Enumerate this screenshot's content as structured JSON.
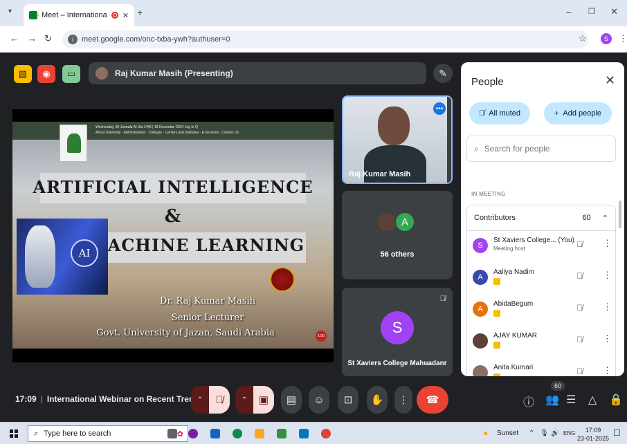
{
  "browser": {
    "tab_title": "Meet – International Webin",
    "new_tab": "+",
    "url": "meet.google.com/onc-txba-ywh?authuser=0",
    "profile_initial": "S"
  },
  "meet": {
    "presenter_label": "Raj Kumar Masih (Presenting)",
    "slide": {
      "title_line1": "ARTIFICIAL INTELLIGENCE",
      "title_line2": "&",
      "title_line3": "MACHINE LEARNING",
      "ai_badge": "AI",
      "author_name": "Dr. Raj Kumar Masih",
      "author_role": "Senior Lecturer",
      "author_org": "Govt. University of Jazan, Saudi Arabia",
      "header_text": "Wednesday, 30 Jumada Al-Ula 1446 | 18 December 2024   Log In  Q",
      "header_nav": "About University · Administration · Colleges · Centers and Institutes · E-Services · Contact Us"
    },
    "tiles": {
      "speaker_name": "Raj Kumar Masih",
      "others_avatar_letter": "A",
      "others_label": "56 others",
      "self_initial": "S",
      "self_name": "St Xaviers College Mahuadanr"
    },
    "people": {
      "title": "People",
      "all_muted": "All muted",
      "add_people": "Add people",
      "search_placeholder": "Search for people",
      "section_label": "IN MEETING",
      "contributors_label": "Contributors",
      "contributors_count": "60",
      "participants": [
        {
          "initial": "S",
          "name": "St Xaviers College... (You)",
          "sub": "Meeting host",
          "color": "#a142f4"
        },
        {
          "initial": "A",
          "name": "Aaliya Nadim",
          "sub": "",
          "color": "#3949ab"
        },
        {
          "initial": "A",
          "name": "AbidaBegum",
          "sub": "",
          "color": "#e8710a"
        },
        {
          "initial": "",
          "name": "AJAY KUMAR",
          "sub": "",
          "color": "#5d4037"
        },
        {
          "initial": "",
          "name": "Anita Kumari",
          "sub": "",
          "color": "#8d6e63"
        }
      ]
    },
    "bottom": {
      "time": "17:09",
      "meeting_title": "International Webinar on Recent Tren...",
      "people_count": "60"
    }
  },
  "taskbar": {
    "search_placeholder": "Type here to search",
    "weather": "Sunset",
    "language": "ENG",
    "time": "17:09",
    "date": "23-01-2025"
  },
  "colors": {
    "meet_bg": "#202124",
    "end_call": "#ea4335",
    "muted_red": "#f9dedc",
    "accent_blue": "#c2e7ff"
  }
}
